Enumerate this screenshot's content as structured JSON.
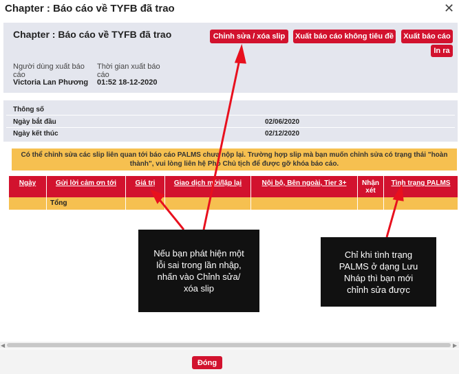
{
  "dialog": {
    "title": "Chapter : Báo cáo về TYFB đã trao",
    "close_icon": "close-icon"
  },
  "header": {
    "title": "Chapter : Báo cáo về TYFB đã trao",
    "buttons": {
      "edit": "Chỉnh sửa / xóa slip",
      "export_untitled": "Xuất báo cáo không tiêu đề",
      "export": "Xuất báo cáo",
      "print": "In ra"
    },
    "exported_by_label_1": "Người dùng xuất báo",
    "exported_by_label_2": "cáo",
    "exported_by_value": "Victoria Lan Phương",
    "exported_time_label_1": "Thời gian xuất báo",
    "exported_time_label_2": "cáo",
    "exported_time_value": "01:52 18-12-2020"
  },
  "params": {
    "title": "Thông số",
    "start_label": "Ngày bắt đầu",
    "start_value": "02/06/2020",
    "end_label": "Ngày kết thúc",
    "end_value": "02/12/2020"
  },
  "notice": {
    "line1": "Có thể chỉnh sửa các slip liên quan tới báo cáo PALMS chưa nộp lại. Trường hợp slip mà bạn muốn chỉnh sửa có trạng thái \"hoàn",
    "line2": "thành\", vui lòng liên hệ Phó Chủ tịch để được gỡ khóa báo cáo."
  },
  "table": {
    "columns": [
      "Ngày",
      "Gửi lời cảm ơn tới",
      "Giá trị",
      "Giao dịch mới/lặp lại",
      "Nội bộ, Bên ngoài, Tier 3+",
      "Nhận",
      "xét",
      "Tình trạng PALMS"
    ],
    "total_label": "Tổng"
  },
  "callouts": {
    "left": [
      "Nếu bạn phát hiện một",
      "lỗi sai trong lần nhập,",
      "nhấn vào Chỉnh sửa/",
      "xóa slip"
    ],
    "right": [
      "Chỉ khi tình trạng",
      "PALMS ở dạng Lưu",
      "Nháp thì bạn mới",
      "chỉnh sửa được"
    ]
  },
  "footer": {
    "close_label": "Đóng"
  },
  "colors": {
    "accent": "#d2122e",
    "notice": "#f6c050",
    "panel": "#e4e6ee"
  }
}
